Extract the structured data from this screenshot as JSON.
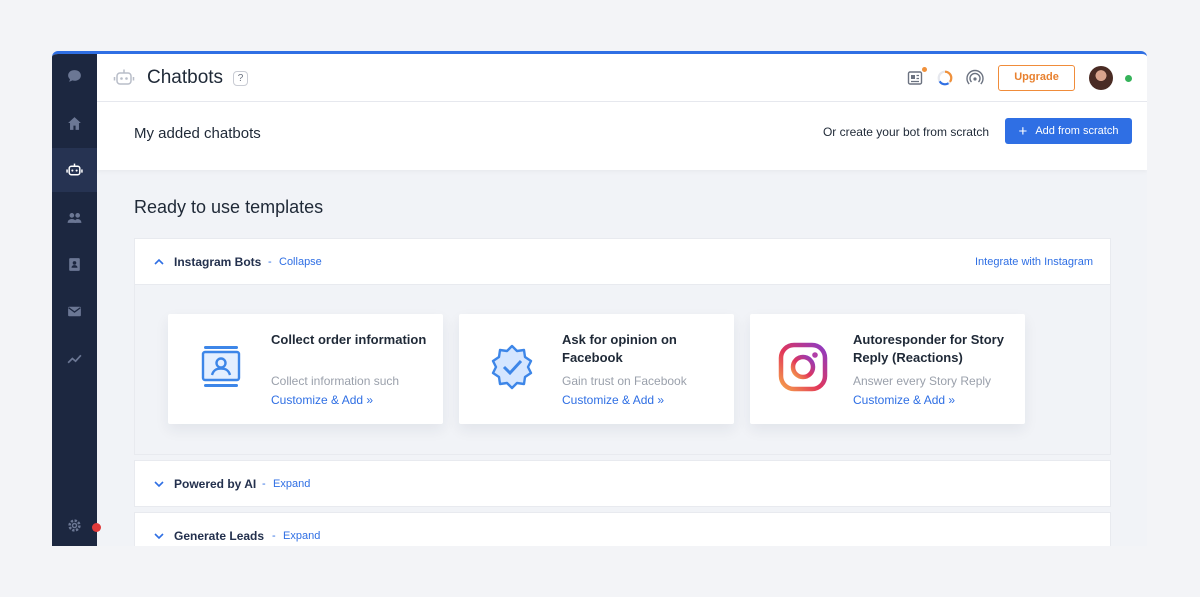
{
  "header": {
    "title": "Chatbots",
    "help": "?",
    "upgrade_label": "Upgrade"
  },
  "subheader": {
    "title": "My added chatbots",
    "or_text": "Or create your bot from scratch",
    "add_label": "Add from scratch",
    "add_icon": "+"
  },
  "templates": {
    "title": "Ready to use templates",
    "groups": [
      {
        "label": "Instagram Bots",
        "separator": "-",
        "action": "Collapse",
        "right_link": "Integrate with Instagram",
        "cards": [
          {
            "title": "Collect order information",
            "desc": "Collect information such",
            "link": "Customize & Add »",
            "icon": "contact-card-icon"
          },
          {
            "title": "Ask for opinion on Facebook",
            "desc": "Gain trust on Facebook",
            "link": "Customize & Add »",
            "icon": "verified-badge-icon"
          },
          {
            "title": "Autoresponder for Story Reply (Reactions)",
            "desc": "Answer every Story Reply",
            "link": "Customize & Add »",
            "icon": "instagram-icon"
          }
        ]
      },
      {
        "label": "Powered by AI",
        "separator": "-",
        "action": "Expand"
      },
      {
        "label": "Generate Leads",
        "separator": "-",
        "action": "Expand"
      }
    ]
  },
  "colors": {
    "accent": "#2f6fe4",
    "sidebar": "#1c2740",
    "upgrade": "#f08c3a"
  }
}
